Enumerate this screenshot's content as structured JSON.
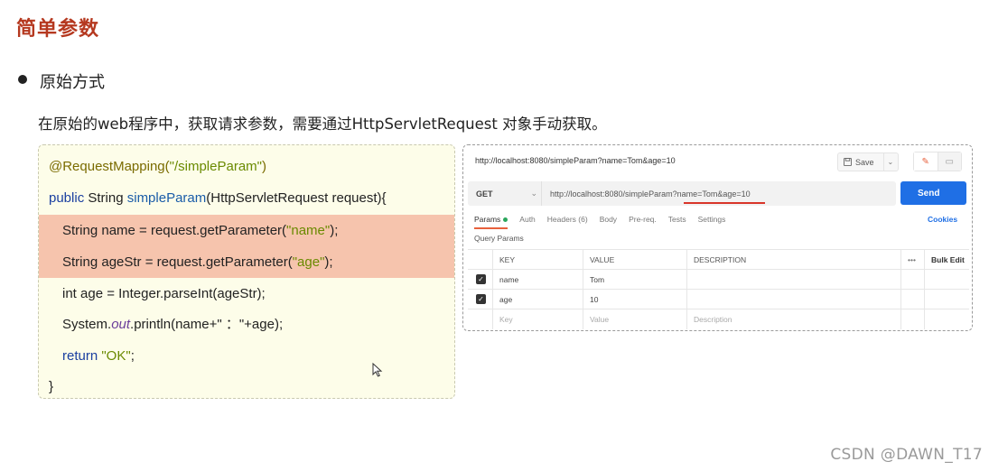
{
  "slide": {
    "title": "简单参数",
    "bullet": "原始方式",
    "description": "在原始的web程序中，获取请求参数，需要通过HttpServletRequest 对象手动获取。"
  },
  "code": {
    "line1_anno": "@RequestMapping(",
    "line1_str": "\"/simpleParam\"",
    "line1_end": ")",
    "line2_kw": "public",
    "line2_a": " String ",
    "line2_fn": "simpleParam",
    "line2_b": "(HttpServletRequest request){",
    "line3_a": "String name = request.getParameter(",
    "line3_str": "\"name\"",
    "line3_b": ");",
    "line4_a": "String ageStr = request.getParameter(",
    "line4_str": "\"age\"",
    "line4_b": ");",
    "line5": "int age = Integer.parseInt(ageStr);",
    "line6_a": "System.",
    "line6_it": "out",
    "line6_b": ".println(name+\" ：\"+age);",
    "line7_kw": "return",
    "line7_str": " \"OK\"",
    "line7_b": ";",
    "line8": "}"
  },
  "postman": {
    "top_url": "http://localhost:8080/simpleParam?name=Tom&age=10",
    "save_label": "Save",
    "method": "GET",
    "request_url": "http://localhost:8080/simpleParam?name=Tom&age=10",
    "send_label": "Send",
    "tabs": [
      "Params",
      "Auth",
      "Headers (6)",
      "Body",
      "Pre-req.",
      "Tests",
      "Settings"
    ],
    "cookies_label": "Cookies",
    "query_params_label": "Query Params",
    "columns": {
      "key": "KEY",
      "value": "VALUE",
      "description": "DESCRIPTION",
      "more": "•••",
      "bulk_edit": "Bulk Edit"
    },
    "rows": [
      {
        "key": "name",
        "value": "Tom",
        "description": "",
        "checked": true
      },
      {
        "key": "age",
        "value": "10",
        "description": "",
        "checked": true
      }
    ],
    "placeholder": {
      "key": "Key",
      "value": "Value",
      "description": "Description"
    },
    "colors": {
      "send": "#1f6fe5",
      "active_tab": "#e8613d",
      "underline": "#d9362a"
    }
  },
  "watermark": "CSDN @DAWN_T17"
}
